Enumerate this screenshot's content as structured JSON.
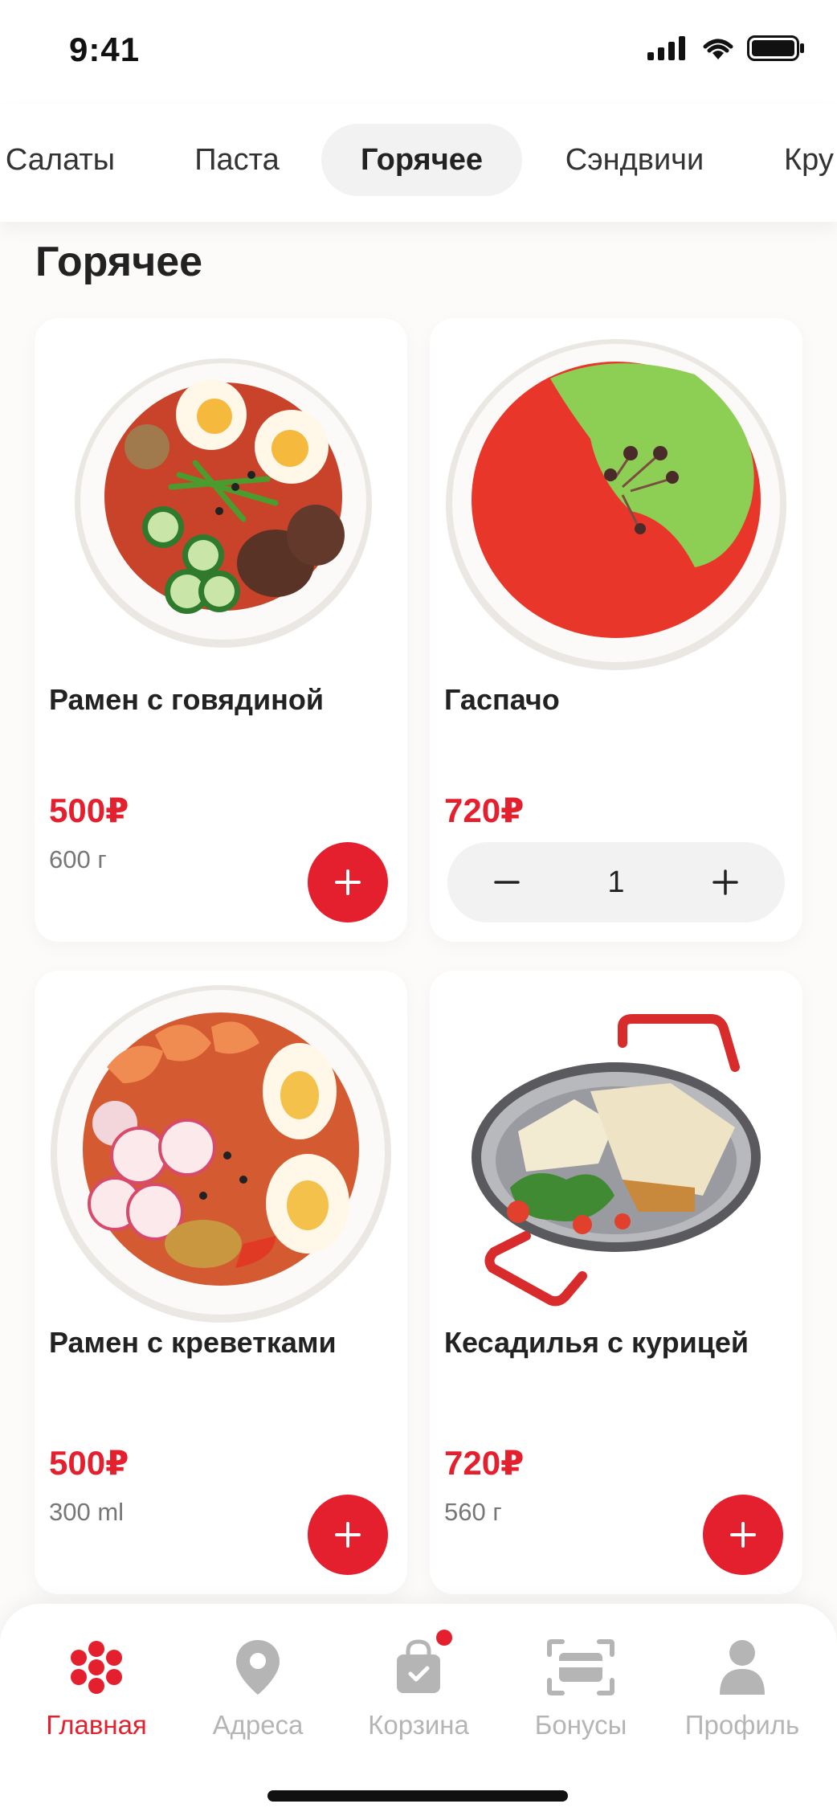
{
  "status_bar": {
    "time": "9:41"
  },
  "tabs": [
    {
      "label": "Салаты",
      "active": false
    },
    {
      "label": "Паста",
      "active": false
    },
    {
      "label": "Горячее",
      "active": true
    },
    {
      "label": "Сэндвичи",
      "active": false
    },
    {
      "label": "Кру",
      "active": false
    }
  ],
  "section": {
    "title": "Горячее"
  },
  "products": [
    {
      "name": "Рамен с говядиной",
      "price": "500₽",
      "weight": "600 г",
      "image": "ramen-beef-image"
    },
    {
      "name": "Гаспачо",
      "price": "720₽",
      "quantity": "1",
      "image": "gazpacho-image"
    },
    {
      "name": "Рамен с креветками",
      "price": "500₽",
      "weight": "300 ml",
      "image": "ramen-shrimp-image"
    },
    {
      "name": "Кесадилья с курицей",
      "price": "720₽",
      "weight": "560 г",
      "image": "quesadilla-image"
    }
  ],
  "bottom_nav": [
    {
      "label": "Главная",
      "icon": "home-flower-icon",
      "active": true
    },
    {
      "label": "Адреса",
      "icon": "location-pin-icon",
      "active": false
    },
    {
      "label": "Корзина",
      "icon": "shopping-bag-icon",
      "active": false,
      "badge": true
    },
    {
      "label": "Бонусы",
      "icon": "scan-card-icon",
      "active": false
    },
    {
      "label": "Профиль",
      "icon": "profile-icon",
      "active": false
    }
  ],
  "colors": {
    "accent": "#e5202e",
    "inactive": "#b5b5b5",
    "tab_active_bg": "#f2f2f2"
  }
}
